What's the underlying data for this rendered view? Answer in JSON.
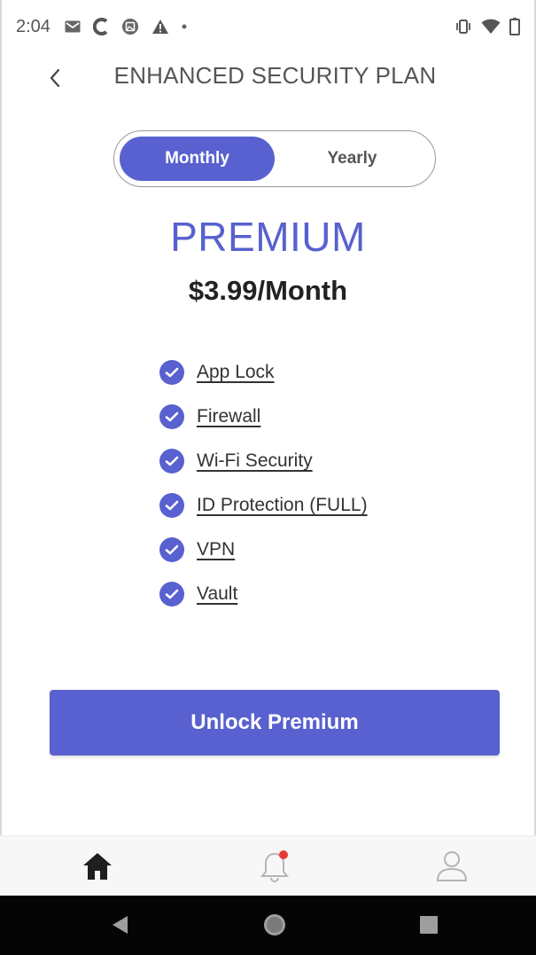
{
  "status_bar": {
    "time": "2:04",
    "left_icons": [
      "gmail-icon",
      "c-app-icon",
      "photo-icon",
      "warning-icon",
      "dot-icon"
    ],
    "right_icons": [
      "vibrate-icon",
      "wifi-icon",
      "battery-icon"
    ]
  },
  "header": {
    "back_icon": "chevron-left-icon",
    "title": "ENHANCED SECURITY PLAN"
  },
  "billing_toggle": {
    "options": [
      {
        "label": "Monthly",
        "selected": true
      },
      {
        "label": "Yearly",
        "selected": false
      }
    ]
  },
  "plan": {
    "name": "PREMIUM",
    "price": "$3.99/Month",
    "features": [
      "App Lock",
      "Firewall",
      "Wi-Fi Security",
      "ID Protection (FULL)",
      "VPN",
      "Vault"
    ]
  },
  "cta": {
    "label": "Unlock Premium"
  },
  "tab_bar": {
    "tabs": [
      {
        "icon": "home-icon",
        "active": true
      },
      {
        "icon": "bell-icon",
        "has_badge": true
      },
      {
        "icon": "profile-icon",
        "active": false
      }
    ]
  },
  "nav_bar": {
    "buttons": [
      "back-triangle-icon",
      "home-circle-icon",
      "recents-square-icon"
    ]
  },
  "colors": {
    "accent": "#5861cf",
    "badge": "#e53935"
  }
}
